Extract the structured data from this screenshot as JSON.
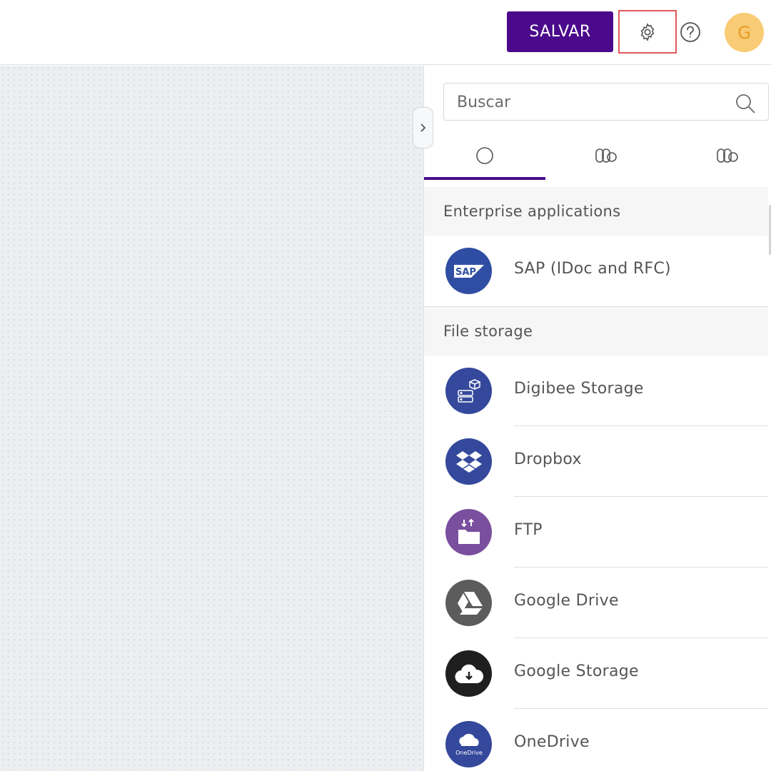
{
  "header": {
    "save_label": "SALVAR",
    "avatar_initial": "G",
    "accent_color": "#4b0a8c",
    "avatar_color": "#f8cb74"
  },
  "panel": {
    "search": {
      "placeholder": "Buscar",
      "icon": "search-icon"
    },
    "tabs": [
      {
        "icon": "circle-icon",
        "active": true
      },
      {
        "icon": "components-icon",
        "active": false
      },
      {
        "icon": "components-alt-icon",
        "active": false
      }
    ],
    "sections": [
      {
        "title": "Enterprise applications",
        "items": [
          {
            "label": "SAP (IDoc and RFC)",
            "icon": "sap-logo-icon",
            "logo_text": "SAP",
            "color": "#2f4ea3"
          }
        ]
      },
      {
        "title": "File storage",
        "items": [
          {
            "label": "Digibee Storage",
            "icon": "storage-icon",
            "color": "#34489c"
          },
          {
            "label": "Dropbox",
            "icon": "dropbox-icon",
            "color": "#34489c"
          },
          {
            "label": "FTP",
            "icon": "ftp-folder-icon",
            "color": "#7a4f9e"
          },
          {
            "label": "Google Drive",
            "icon": "google-drive-icon",
            "color": "#5c5c5c"
          },
          {
            "label": "Google Storage",
            "icon": "google-storage-icon",
            "color": "#1f1f1f"
          },
          {
            "label": "OneDrive",
            "icon": "onedrive-icon",
            "logo_text": "OneDrive",
            "color": "#34489c"
          }
        ]
      }
    ]
  }
}
